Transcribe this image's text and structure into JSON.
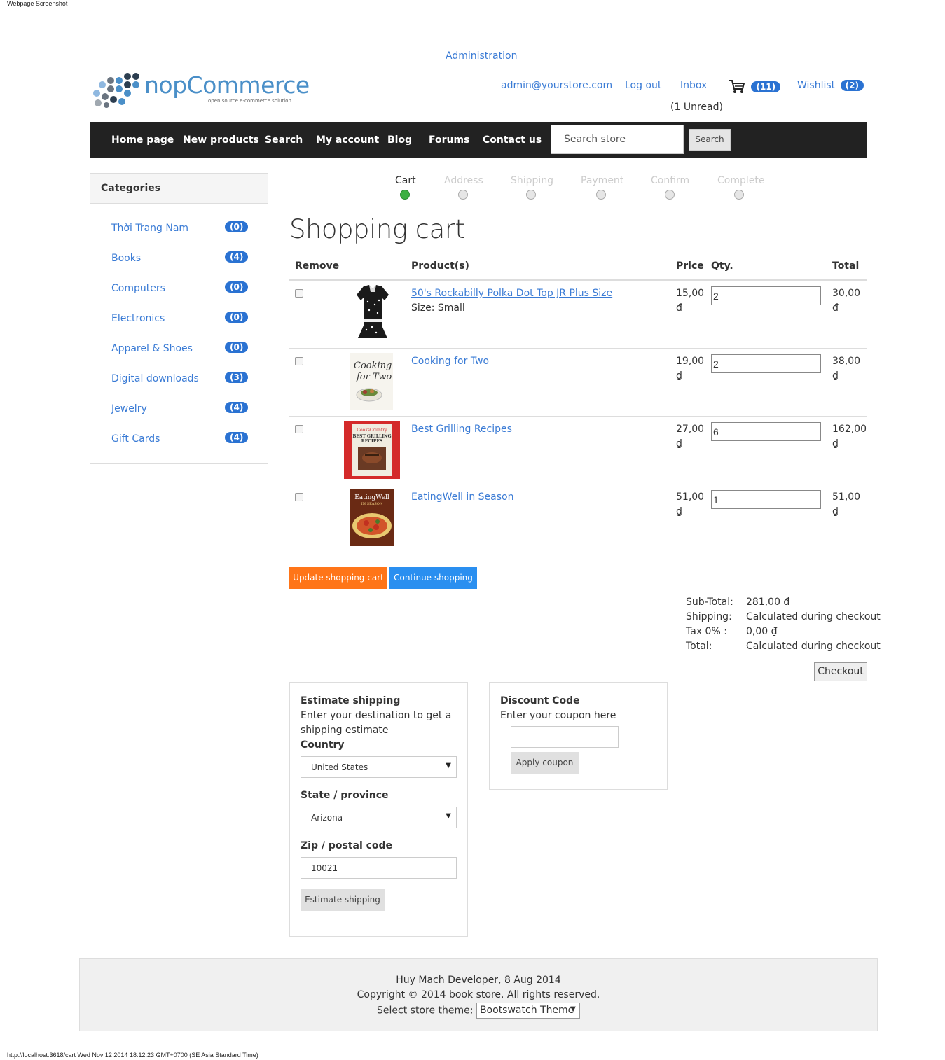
{
  "top_caption": "Webpage Screenshot",
  "header": {
    "admin_link": "Administration",
    "logo_main": "nopCommerce",
    "logo_tagline": "open source e-commerce solution",
    "email": "admin@yourstore.com",
    "logout": "Log out",
    "inbox": "Inbox",
    "unread": "(1 Unread)",
    "cart_count": "(11)",
    "wishlist": "Wishlist",
    "wishlist_count": "(2)",
    "cart_icon": "shopping-cart-icon"
  },
  "nav": {
    "items": [
      "Home page",
      "New products",
      "Search",
      "My account",
      "Blog",
      "Forums",
      "Contact us"
    ],
    "search_placeholder": "Search store",
    "search_button": "Search"
  },
  "sidebar": {
    "title": "Categories",
    "items": [
      {
        "label": "Thời Trang Nam",
        "count": "(0)"
      },
      {
        "label": "Books",
        "count": "(4)"
      },
      {
        "label": "Computers",
        "count": "(0)"
      },
      {
        "label": "Electronics",
        "count": "(0)"
      },
      {
        "label": "Apparel & Shoes",
        "count": "(0)"
      },
      {
        "label": "Digital downloads",
        "count": "(3)"
      },
      {
        "label": "Jewelry",
        "count": "(4)"
      },
      {
        "label": "Gift Cards",
        "count": "(4)"
      }
    ]
  },
  "steps": {
    "items": [
      "Cart",
      "Address",
      "Shipping",
      "Payment",
      "Confirm",
      "Complete"
    ],
    "active_index": 0,
    "active_color": "#3cb043"
  },
  "cart": {
    "title": "Shopping cart",
    "headers": {
      "remove": "Remove",
      "products": "Product(s)",
      "price": "Price",
      "qty": "Qty.",
      "total": "Total"
    },
    "rows": [
      {
        "name": "50's Rockabilly Polka Dot Top JR Plus Size",
        "attr": "Size: Small",
        "price": "15,00",
        "currency": "₫",
        "qty": "2",
        "total": "30,00",
        "image": "polka-dot-top-image"
      },
      {
        "name": "Cooking for Two",
        "attr": "",
        "price": "19,00",
        "currency": "₫",
        "qty": "2",
        "total": "38,00",
        "image": "cooking-for-two-book-image"
      },
      {
        "name": "Best Grilling Recipes",
        "attr": "",
        "price": "27,00",
        "currency": "₫",
        "qty": "6",
        "total": "162,00",
        "image": "best-grilling-recipes-book-image"
      },
      {
        "name": "EatingWell in Season",
        "attr": "",
        "price": "51,00",
        "currency": "₫",
        "qty": "1",
        "total": "51,00",
        "image": "eatingwell-in-season-book-image"
      }
    ],
    "update_button": "Update shopping cart",
    "continue_button": "Continue shopping"
  },
  "totals": {
    "subtotal_label": "Sub-Total:",
    "subtotal_value": "281,00 ₫",
    "shipping_label": "Shipping:",
    "shipping_value": "Calculated during checkout",
    "tax_label": "Tax 0% :",
    "tax_value": "0,00 ₫",
    "total_label": "Total:",
    "total_value": "Calculated during checkout",
    "checkout_button": "Checkout"
  },
  "estimate": {
    "title": "Estimate shipping",
    "hint": "Enter your destination to get a shipping estimate",
    "country_label": "Country",
    "country_value": "United States",
    "state_label": "State / province",
    "state_value": "Arizona",
    "zip_label": "Zip / postal code",
    "zip_value": "10021",
    "button": "Estimate shipping"
  },
  "discount": {
    "title": "Discount Code",
    "hint": "Enter your coupon here",
    "coupon_value": "",
    "button": "Apply coupon"
  },
  "footer": {
    "line1": "Huy Mach Developer, 8 Aug 2014",
    "line2": "Copyright © 2014 book store. All rights reserved.",
    "theme_label": "Select store theme:",
    "theme_value": "Bootswatch Theme"
  },
  "status_bar": "http://localhost:3618/cart Wed Nov 12 2014 18:12:23 GMT+0700 (SE Asia Standard Time)"
}
